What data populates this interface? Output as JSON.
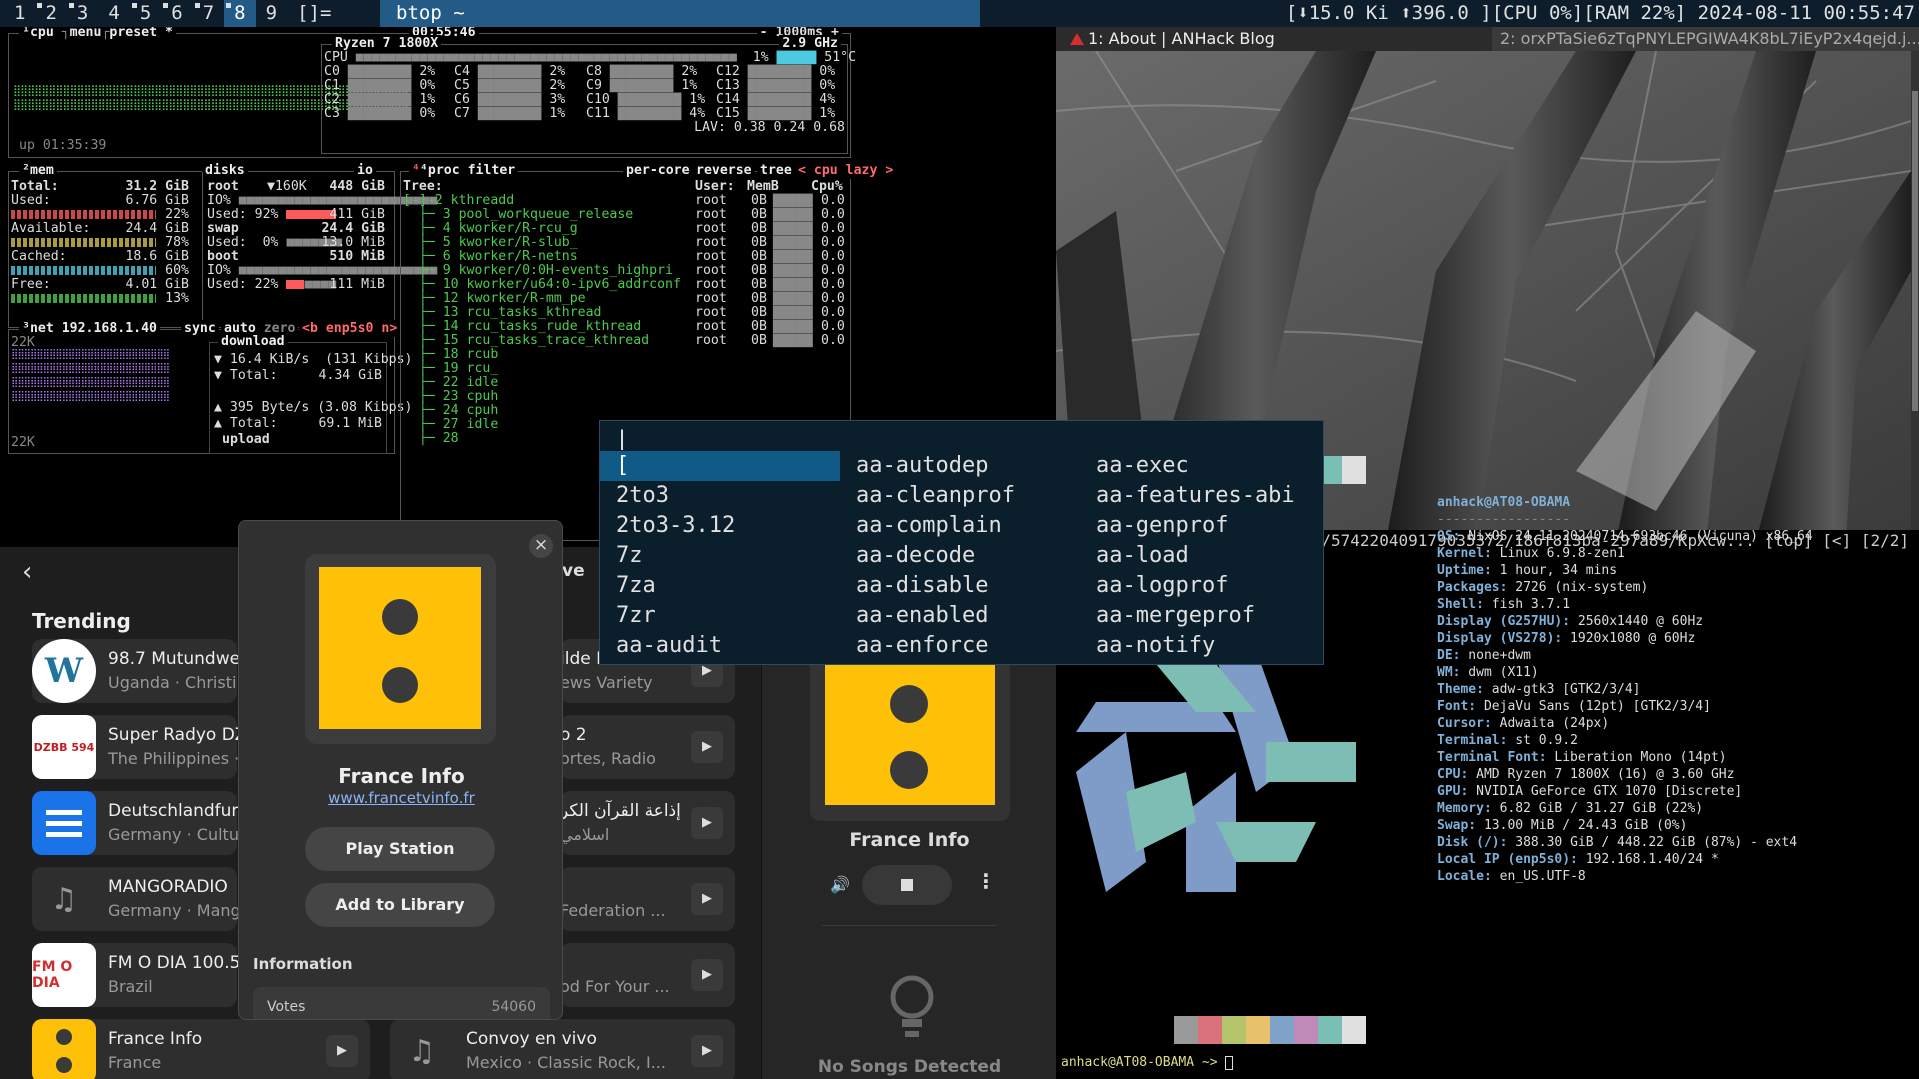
{
  "topbar": {
    "tags": [
      "1",
      "2",
      "3",
      "4",
      "5",
      "6",
      "7",
      "8",
      "9"
    ],
    "tag_dots": [
      false,
      true,
      true,
      false,
      true,
      true,
      true,
      true,
      false
    ],
    "selected_tag": "8",
    "layout": "[]=",
    "window_title": "btop ~",
    "status": "[⬇15.0 Ki ⬆396.0 ][CPU 0%][RAM 22%] 2024-08-11 00:55:47"
  },
  "btop": {
    "cpu_title": "¹cpu",
    "menu": "menu",
    "preset": "preset *",
    "clock": "00:55:46",
    "refresh": "- 1000ms +",
    "uptime": "up 01:35:39",
    "cpu_model": "Ryzen 7 1800X",
    "cpu_freq": "2.9 GHz",
    "cpu_total_label": "CPU",
    "cpu_total_pct": "1%",
    "cpu_temp": "51°C",
    "cores": [
      {
        "label": "C0",
        "pct": "2%"
      },
      {
        "label": "C4",
        "pct": "2%"
      },
      {
        "label": "C8",
        "pct": "2%"
      },
      {
        "label": "C12",
        "pct": "0%"
      },
      {
        "label": "C1",
        "pct": "0%"
      },
      {
        "label": "C5",
        "pct": "2%"
      },
      {
        "label": "C9",
        "pct": "1%"
      },
      {
        "label": "C13",
        "pct": "0%"
      },
      {
        "label": "C2",
        "pct": "1%"
      },
      {
        "label": "C6",
        "pct": "3%"
      },
      {
        "label": "C10",
        "pct": "1%"
      },
      {
        "label": "C14",
        "pct": "4%"
      },
      {
        "label": "C3",
        "pct": "0%"
      },
      {
        "label": "C7",
        "pct": "1%"
      },
      {
        "label": "C11",
        "pct": "4%"
      },
      {
        "label": "C15",
        "pct": "1%"
      }
    ],
    "lav": "LAV: 0.38 0.24 0.68",
    "mem": {
      "title": "²mem",
      "total_label": "Total:",
      "total": "31.2 GiB",
      "used_label": "Used:",
      "used": "6.76 GiB",
      "used_pct": "22%",
      "available_label": "Available:",
      "available": "24.4 GiB",
      "available_pct": "78%",
      "cached_label": "Cached:",
      "cached": "18.6 GiB",
      "cached_pct": "60%",
      "free_label": "Free:",
      "free": "4.01 GiB",
      "free_pct": "13%"
    },
    "disks": {
      "title": "disks",
      "io": "io",
      "root_label": "root",
      "root_io_rate": "▼160K",
      "root_size": "448 GiB",
      "root_io": "IO%",
      "root_used_label": "Used:",
      "root_used_pct": "92%",
      "root_used": "411 GiB",
      "swap_label": "swap",
      "swap_size": "24.4 GiB",
      "swap_used_label": "Used:",
      "swap_used_pct": "0%",
      "swap_used": "13.0 MiB",
      "boot_label": "boot",
      "boot_size": "510 MiB",
      "boot_io": "IO%",
      "boot_used_label": "Used:",
      "boot_used_pct": "22%",
      "boot_used": "111 MiB"
    },
    "net": {
      "title": "³net",
      "ip": "192.168.1.40",
      "sync": "sync",
      "auto": "auto",
      "zero": "zero",
      "iface": "<b enp5s0 n>",
      "scale_top": "22K",
      "scale_bottom": "22K",
      "download_label": "download",
      "down_rate": "▼ 16.4 KiB/s  (131 Kibps)",
      "down_total_label": "▼ Total:",
      "down_total": "4.34 GiB",
      "up_rate": "▲ 395 Byte/s (3.08 Kibps)",
      "up_total_label": "▲ Total:",
      "up_total": "69.1 MiB",
      "upload_label": "upload"
    },
    "proc": {
      "title": "⁴proc",
      "filter": "filter",
      "per_core": "per-core",
      "reverse": "reverse",
      "tree": "tree",
      "sort": "< cpu lazy >",
      "headers": {
        "tree": "Tree:",
        "user": "User:",
        "mem": "MemB",
        "cpu": "Cpu%"
      },
      "rows": [
        {
          "tree": "[-]-2 kthreadd",
          "user": "root",
          "mem": "0B",
          "cpu": "0.0"
        },
        {
          "tree": "  ├─ 3 pool_workqueue_release",
          "user": "root",
          "mem": "0B",
          "cpu": "0.0"
        },
        {
          "tree": "  ├─ 4 kworker/R-rcu_g",
          "user": "root",
          "mem": "0B",
          "cpu": "0.0"
        },
        {
          "tree": "  ├─ 5 kworker/R-slub_",
          "user": "root",
          "mem": "0B",
          "cpu": "0.0"
        },
        {
          "tree": "  ├─ 6 kworker/R-netns",
          "user": "root",
          "mem": "0B",
          "cpu": "0.0"
        },
        {
          "tree": "  ├─ 9 kworker/0:0H-events_highpri",
          "user": "root",
          "mem": "0B",
          "cpu": "0.0"
        },
        {
          "tree": "  ├─ 10 kworker/u64:0-ipv6_addrconf",
          "user": "root",
          "mem": "0B",
          "cpu": "0.0"
        },
        {
          "tree": "  ├─ 12 kworker/R-mm_pe",
          "user": "root",
          "mem": "0B",
          "cpu": "0.0"
        },
        {
          "tree": "  ├─ 13 rcu_tasks_kthread",
          "user": "root",
          "mem": "0B",
          "cpu": "0.0"
        },
        {
          "tree": "  ├─ 14 rcu_tasks_rude_kthread",
          "user": "root",
          "mem": "0B",
          "cpu": "0.0"
        },
        {
          "tree": "  ├─ 15 rcu_tasks_trace_kthread",
          "user": "root",
          "mem": "0B",
          "cpu": "0.0"
        },
        {
          "tree": "  ├─ 18 rcub",
          "user": "",
          "mem": "",
          "cpu": ""
        },
        {
          "tree": "  ├─ 19 rcu_",
          "user": "",
          "mem": "",
          "cpu": ""
        },
        {
          "tree": "  ├─ 22 idle",
          "user": "",
          "mem": "",
          "cpu": ""
        },
        {
          "tree": "  ├─ 23 cpuh",
          "user": "",
          "mem": "",
          "cpu": ""
        },
        {
          "tree": "  ├─ 24 cpuh",
          "user": "",
          "mem": "",
          "cpu": ""
        },
        {
          "tree": "  ├─ 27 idle",
          "user": "",
          "mem": "",
          "cpu": ""
        },
        {
          "tree": "  ├─ 28 ",
          "user": "",
          "mem": "",
          "cpu": ""
        }
      ]
    }
  },
  "image_viewer": {
    "tab1": "1: About | ANHack Blog",
    "tab2": "2: orxPTaSie6zTqPNYLEPGIWA4K8bL7iEyP2x4qejd.j...",
    "status": "/m/_v2/574220409179035372/186f813ba-297a89/KpXcw... [top] [<] [2/2]"
  },
  "fastfetch": {
    "user_host": "anhack@AT08-OBAMA",
    "separator": "-----------------",
    "lines": [
      {
        "key": "OS:",
        "val": " NixOS 24.11.20240714.693bc46 (Vicuna) x86_64"
      },
      {
        "key": "Kernel:",
        "val": " Linux 6.9.8-zen1"
      },
      {
        "key": "Uptime:",
        "val": " 1 hour, 34 mins"
      },
      {
        "key": "Packages:",
        "val": " 2726 (nix-system)"
      },
      {
        "key": "Shell:",
        "val": " fish 3.7.1"
      },
      {
        "key": "Display (G257HU):",
        "val": " 2560x1440 @ 60Hz"
      },
      {
        "key": "Display (VS278):",
        "val": " 1920x1080 @ 60Hz"
      },
      {
        "key": "DE:",
        "val": " none+dwm"
      },
      {
        "key": "WM:",
        "val": " dwm (X11)"
      },
      {
        "key": "Theme:",
        "val": " adw-gtk3 [GTK2/3/4]"
      },
      {
        "key": "Font:",
        "val": " DejaVu Sans (12pt) [GTK2/3/4]"
      },
      {
        "key": "Cursor:",
        "val": " Adwaita (24px)"
      },
      {
        "key": "Terminal:",
        "val": " st 0.9.2"
      },
      {
        "key": "Terminal Font:",
        "val": " Liberation Mono (14pt)"
      },
      {
        "key": "CPU:",
        "val": " AMD Ryzen 7 1800X (16) @ 3.60 GHz"
      },
      {
        "key": "GPU:",
        "val": " NVIDIA GeForce GTX 1070 [Discrete]"
      },
      {
        "key": "Memory:",
        "val": " 6.82 GiB / 31.27 GiB (22%)"
      },
      {
        "key": "Swap:",
        "val": " 13.00 MiB / 24.43 GiB (0%)"
      },
      {
        "key": "Disk (/):",
        "val": " 388.30 GiB / 448.22 GiB (87%) - ext4"
      },
      {
        "key": "Local IP (enp5s0):",
        "val": " 192.168.1.40/24 *"
      },
      {
        "key": "Locale:",
        "val": " en_US.UTF-8"
      }
    ],
    "palette": [
      "#9a9a9a",
      "#d9727a",
      "#b4c46a",
      "#e7c26b",
      "#7fa2c9",
      "#c08ab8",
      "#79bfb3",
      "#e0e0e0"
    ],
    "prompt": "anhack@AT08-OBAMA ~> "
  },
  "radio": {
    "back": "‹",
    "trending": "Trending",
    "stations": [
      {
        "name": "98.7 Mutundwe",
        "sub": "Uganda · Christi"
      },
      {
        "name": "Super Radyo DZ",
        "sub": "The Philippines ·"
      },
      {
        "name": "Deutschlandfunk",
        "sub": "Germany · Cultu"
      },
      {
        "name": "MANGORADIO",
        "sub": "Germany · Mang"
      },
      {
        "name": "FM O DIA 100.5",
        "sub": "Brazil"
      },
      {
        "name": "France Info",
        "sub": "France"
      }
    ],
    "right_col": [
      {
        "name": "ilde Fm",
        "sub": "ews Variety"
      },
      {
        "name": "o 2",
        "sub": "ortes, Radio"
      },
      {
        "name": "إذاعة القرآن الكر",
        "sub": "اسلامي"
      },
      {
        "name": "",
        "sub": "Federation ..."
      },
      {
        "name": "",
        "sub": "od For Your ..."
      },
      {
        "name": "Convoy en vivo",
        "sub": "Mexico · Classic Rock, I..."
      }
    ],
    "partial_header": "ve",
    "player": {
      "station": "France Info",
      "no_songs": "No Songs Detected"
    },
    "popup": {
      "close": "×",
      "station": "France Info",
      "url": "www.francetvinfo.fr",
      "play": "Play Station",
      "add": "Add to Library",
      "info": "Information",
      "votes_label": "Votes",
      "votes": "54060"
    }
  },
  "completion": {
    "input": "|",
    "columns": [
      [
        "[",
        "2to3",
        "2to3-3.12",
        "7z",
        "7za",
        "7zr",
        "aa-audit"
      ],
      [
        "aa-autodep",
        "aa-cleanprof",
        "aa-complain",
        "aa-decode",
        "aa-disable",
        "aa-enabled",
        "aa-enforce"
      ],
      [
        "aa-exec",
        "aa-features-abi",
        "aa-genprof",
        "aa-load",
        "aa-logprof",
        "aa-mergeprof",
        "aa-notify"
      ]
    ]
  },
  "colors": {
    "topbar_bg": "#0d1d2b",
    "accent": "#245b86",
    "btop_green": "#4ec94e",
    "btop_red": "#ff5a5a",
    "radio_yellow": "#ffc107",
    "completion_bg": "#0b1e2b"
  }
}
